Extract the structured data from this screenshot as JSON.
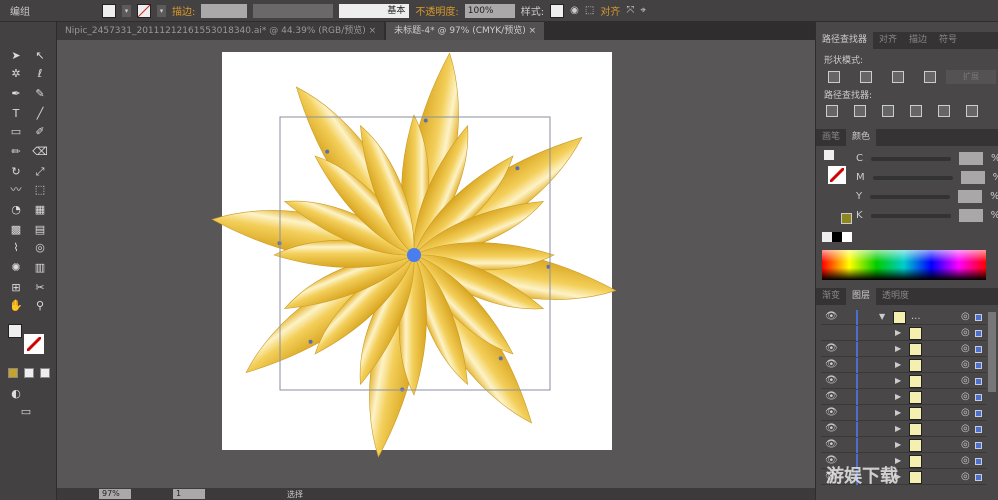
{
  "control_bar": {
    "selection_label": "编组",
    "stroke_label": "描边:",
    "stroke_style": "基本",
    "opacity_label": "不透明度:",
    "opacity_value": "100%",
    "style_label": "样式:",
    "align_label": "对齐"
  },
  "tabs": [
    {
      "label": "Nipic_2457331_20111212161553018340.ai* @ 44.39% (RGB/预览)",
      "active": false
    },
    {
      "label": "未标题-4* @ 97% (CMYK/预览)",
      "active": true
    }
  ],
  "pathfinder": {
    "tabs": [
      "路径查找器",
      "对齐",
      "描边",
      "符号"
    ],
    "shape_modes": "形状模式:",
    "expand": "扩展",
    "pathfinders": "路径查找器:"
  },
  "color": {
    "tabs": [
      "画笔",
      "颜色"
    ],
    "channels": [
      "C",
      "M",
      "Y",
      "K"
    ],
    "unit": "%",
    "accent": "#e9b82e"
  },
  "layers": {
    "tabs": [
      "渐变",
      "图层",
      "透明度"
    ],
    "ellipsis": "..."
  },
  "status": {
    "zoom": "97%",
    "page": "1",
    "tool": "选择"
  },
  "watermark": "游娱下载"
}
